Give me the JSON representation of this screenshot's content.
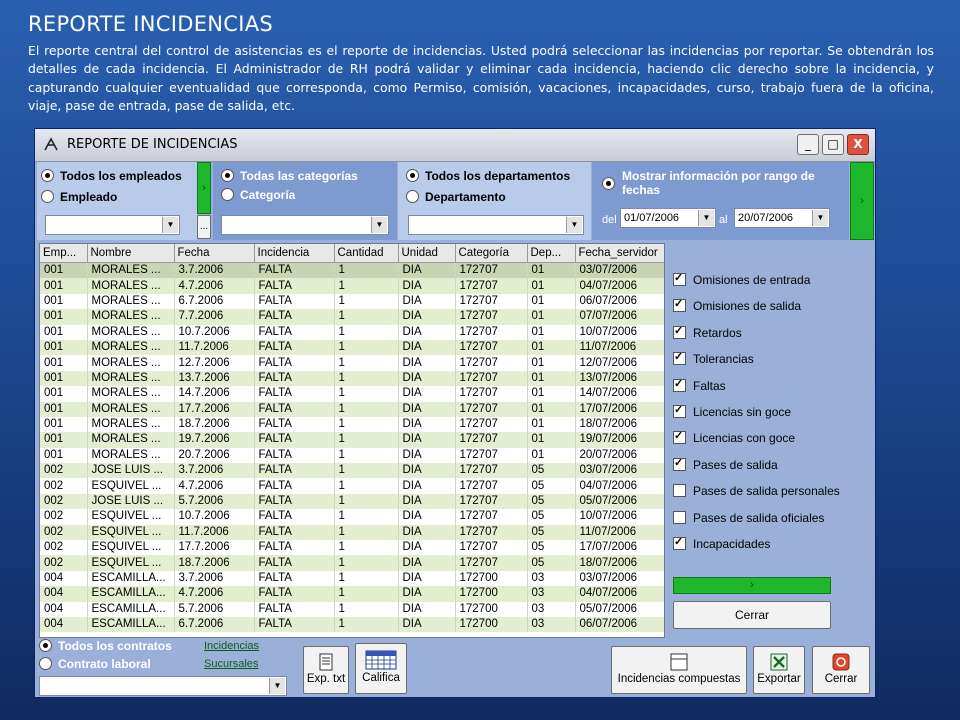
{
  "slide": {
    "title": "REPORTE INCIDENCIAS",
    "description": "El reporte central del control de asistencias es el reporte de incidencias. Usted podrá seleccionar las incidencias por reportar.  Se obtendrán los detalles de cada incidencia. El Administrador de RH podrá validar y eliminar cada incidencia, haciendo clic derecho sobre la incidencia, y capturando cualquier eventualidad que corresponda, como Permiso, comisión, vacaciones, incapacidades, curso, trabajo fuera de la oficina, viaje, pase de entrada, pase de salida, etc."
  },
  "window": {
    "title": "REPORTE DE INCIDENCIAS",
    "minimize": "_",
    "maximize": "□",
    "close": "X"
  },
  "filters": {
    "employees": {
      "all_label": "Todos los empleados",
      "one_label": "Empleado",
      "selected": "all",
      "combo_value": ""
    },
    "categories": {
      "all_label": "Todas las categorías",
      "one_label": "Categoría",
      "selected": "all",
      "combo_value": ""
    },
    "departments": {
      "all_label": "Todos los departamentos",
      "one_label": "Departamento",
      "selected": "all",
      "combo_value": ""
    },
    "dates": {
      "label": "Mostrar información por rango de fechas",
      "from_label": "del",
      "from_value": "01/07/2006",
      "to_label": "al",
      "to_value": "20/07/2006"
    },
    "arrow": "›",
    "ellipsis": "..."
  },
  "grid": {
    "columns": [
      "Emp...",
      "Nombre",
      "Fecha",
      "Incidencia",
      "Cantidad",
      "Unidad",
      "Categoría",
      "Dep...",
      "Fecha_servidor"
    ],
    "rows": [
      [
        "001",
        "MORALES ...",
        "3.7.2006",
        "FALTA",
        "1",
        "DIA",
        "172707",
        "01",
        "03/07/2006"
      ],
      [
        "001",
        "MORALES ...",
        "4.7.2006",
        "FALTA",
        "1",
        "DIA",
        "172707",
        "01",
        "04/07/2006"
      ],
      [
        "001",
        "MORALES ...",
        "6.7.2006",
        "FALTA",
        "1",
        "DIA",
        "172707",
        "01",
        "06/07/2006"
      ],
      [
        "001",
        "MORALES ...",
        "7.7.2006",
        "FALTA",
        "1",
        "DIA",
        "172707",
        "01",
        "07/07/2006"
      ],
      [
        "001",
        "MORALES ...",
        "10.7.2006",
        "FALTA",
        "1",
        "DIA",
        "172707",
        "01",
        "10/07/2006"
      ],
      [
        "001",
        "MORALES ...",
        "11.7.2006",
        "FALTA",
        "1",
        "DIA",
        "172707",
        "01",
        "11/07/2006"
      ],
      [
        "001",
        "MORALES ...",
        "12.7.2006",
        "FALTA",
        "1",
        "DIA",
        "172707",
        "01",
        "12/07/2006"
      ],
      [
        "001",
        "MORALES ...",
        "13.7.2006",
        "FALTA",
        "1",
        "DIA",
        "172707",
        "01",
        "13/07/2006"
      ],
      [
        "001",
        "MORALES ...",
        "14.7.2006",
        "FALTA",
        "1",
        "DIA",
        "172707",
        "01",
        "14/07/2006"
      ],
      [
        "001",
        "MORALES ...",
        "17.7.2006",
        "FALTA",
        "1",
        "DIA",
        "172707",
        "01",
        "17/07/2006"
      ],
      [
        "001",
        "MORALES ...",
        "18.7.2006",
        "FALTA",
        "1",
        "DIA",
        "172707",
        "01",
        "18/07/2006"
      ],
      [
        "001",
        "MORALES ...",
        "19.7.2006",
        "FALTA",
        "1",
        "DIA",
        "172707",
        "01",
        "19/07/2006"
      ],
      [
        "001",
        "MORALES ...",
        "20.7.2006",
        "FALTA",
        "1",
        "DIA",
        "172707",
        "01",
        "20/07/2006"
      ],
      [
        "002",
        "JOSE LUIS ...",
        "3.7.2006",
        "FALTA",
        "1",
        "DIA",
        "172707",
        "05",
        "03/07/2006"
      ],
      [
        "002",
        "ESQUIVEL ...",
        "4.7.2006",
        "FALTA",
        "1",
        "DIA",
        "172707",
        "05",
        "04/07/2006"
      ],
      [
        "002",
        "JOSE LUIS ...",
        "5.7.2006",
        "FALTA",
        "1",
        "DIA",
        "172707",
        "05",
        "05/07/2006"
      ],
      [
        "002",
        "ESQUIVEL ...",
        "10.7.2006",
        "FALTA",
        "1",
        "DIA",
        "172707",
        "05",
        "10/07/2006"
      ],
      [
        "002",
        "ESQUIVEL ...",
        "11.7.2006",
        "FALTA",
        "1",
        "DIA",
        "172707",
        "05",
        "11/07/2006"
      ],
      [
        "002",
        "ESQUIVEL ...",
        "17.7.2006",
        "FALTA",
        "1",
        "DIA",
        "172707",
        "05",
        "17/07/2006"
      ],
      [
        "002",
        "ESQUIVEL ...",
        "18.7.2006",
        "FALTA",
        "1",
        "DIA",
        "172707",
        "05",
        "18/07/2006"
      ],
      [
        "004",
        "ESCAMILLA...",
        "3.7.2006",
        "FALTA",
        "1",
        "DIA",
        "172700",
        "03",
        "03/07/2006"
      ],
      [
        "004",
        "ESCAMILLA...",
        "4.7.2006",
        "FALTA",
        "1",
        "DIA",
        "172700",
        "03",
        "04/07/2006"
      ],
      [
        "004",
        "ESCAMILLA...",
        "5.7.2006",
        "FALTA",
        "1",
        "DIA",
        "172700",
        "03",
        "05/07/2006"
      ],
      [
        "004",
        "ESCAMILLA...",
        "6.7.2006",
        "FALTA",
        "1",
        "DIA",
        "172700",
        "03",
        "06/07/2006"
      ]
    ],
    "selected_row": 0
  },
  "checkboxes": [
    {
      "label": "Omisiones de entrada",
      "checked": true
    },
    {
      "label": "Omisiones de salida",
      "checked": true
    },
    {
      "label": "Retardos",
      "checked": true
    },
    {
      "label": "Tolerancias",
      "checked": true
    },
    {
      "label": "Faltas",
      "checked": true
    },
    {
      "label": "Licencias sin goce",
      "checked": true
    },
    {
      "label": "Licencias con goce",
      "checked": true
    },
    {
      "label": "Pases de salida",
      "checked": true
    },
    {
      "label": "Pases de salida personales",
      "checked": false
    },
    {
      "label": "Pases de salida oficiales",
      "checked": false
    },
    {
      "label": "Incapacidades",
      "checked": true
    }
  ],
  "side_buttons": {
    "run_arrow": "›",
    "close_label": "Cerrar"
  },
  "contracts": {
    "all_label": "Todos los contratos",
    "one_label": "Contrato laboral",
    "selected": "all",
    "combo_value": "",
    "link_incidencias": "Incidencias",
    "link_sucursales": "Sucursales"
  },
  "toolbar": {
    "exp_txt": "Exp. txt",
    "califica": "Califica",
    "compuestas": "Incidencias compuestas",
    "exportar": "Exportar",
    "cerrar": "Cerrar"
  },
  "colors": {
    "window_bg": "#9bb0d8",
    "panel_blue": "#7d9bd0",
    "panel_light": "#a8c0e8",
    "accent_green": "#1fb82c",
    "row_alt": "#e3edd0"
  }
}
